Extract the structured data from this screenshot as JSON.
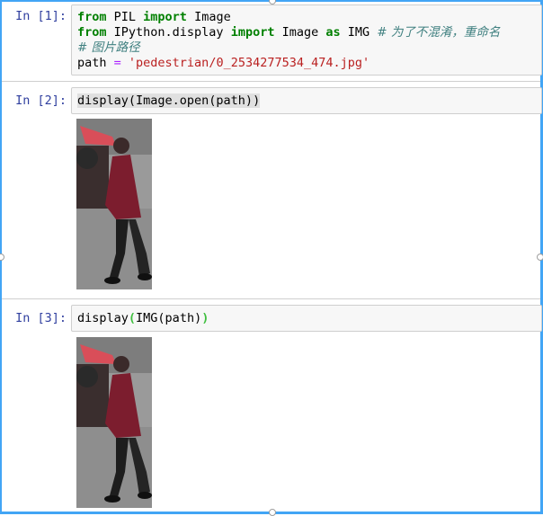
{
  "cells": [
    {
      "prompt": "In [1]:",
      "lines": {
        "l1_kw1": "from",
        "l1_mod": " PIL ",
        "l1_kw2": "import",
        "l1_name": " Image",
        "l2_kw1": "from",
        "l2_mod": " IPython.display ",
        "l2_kw2": "import",
        "l2_name": " Image ",
        "l2_kw3": "as",
        "l2_alias": " IMG ",
        "l2_comment": "# 为了不混淆，重命名",
        "l3_comment": "# 图片路径",
        "l4_var": "path ",
        "l4_eq": "=",
        "l4_str": " 'pedestrian/0_2534277534_474.jpg'"
      }
    },
    {
      "prompt": "In [2]:",
      "lines": {
        "code": "display(Image.open(path))"
      }
    },
    {
      "prompt": "In [3]:",
      "lines": {
        "pre": "display",
        "open": "(",
        "mid": "IMG(path)",
        "close": ")"
      }
    }
  ],
  "colors": {
    "prompt": "#303f9f",
    "keyword": "#008000",
    "string": "#ba2121",
    "comment": "#408080",
    "selected_frame": "#42a5f5"
  },
  "output_image": {
    "alt": "pedestrian"
  }
}
